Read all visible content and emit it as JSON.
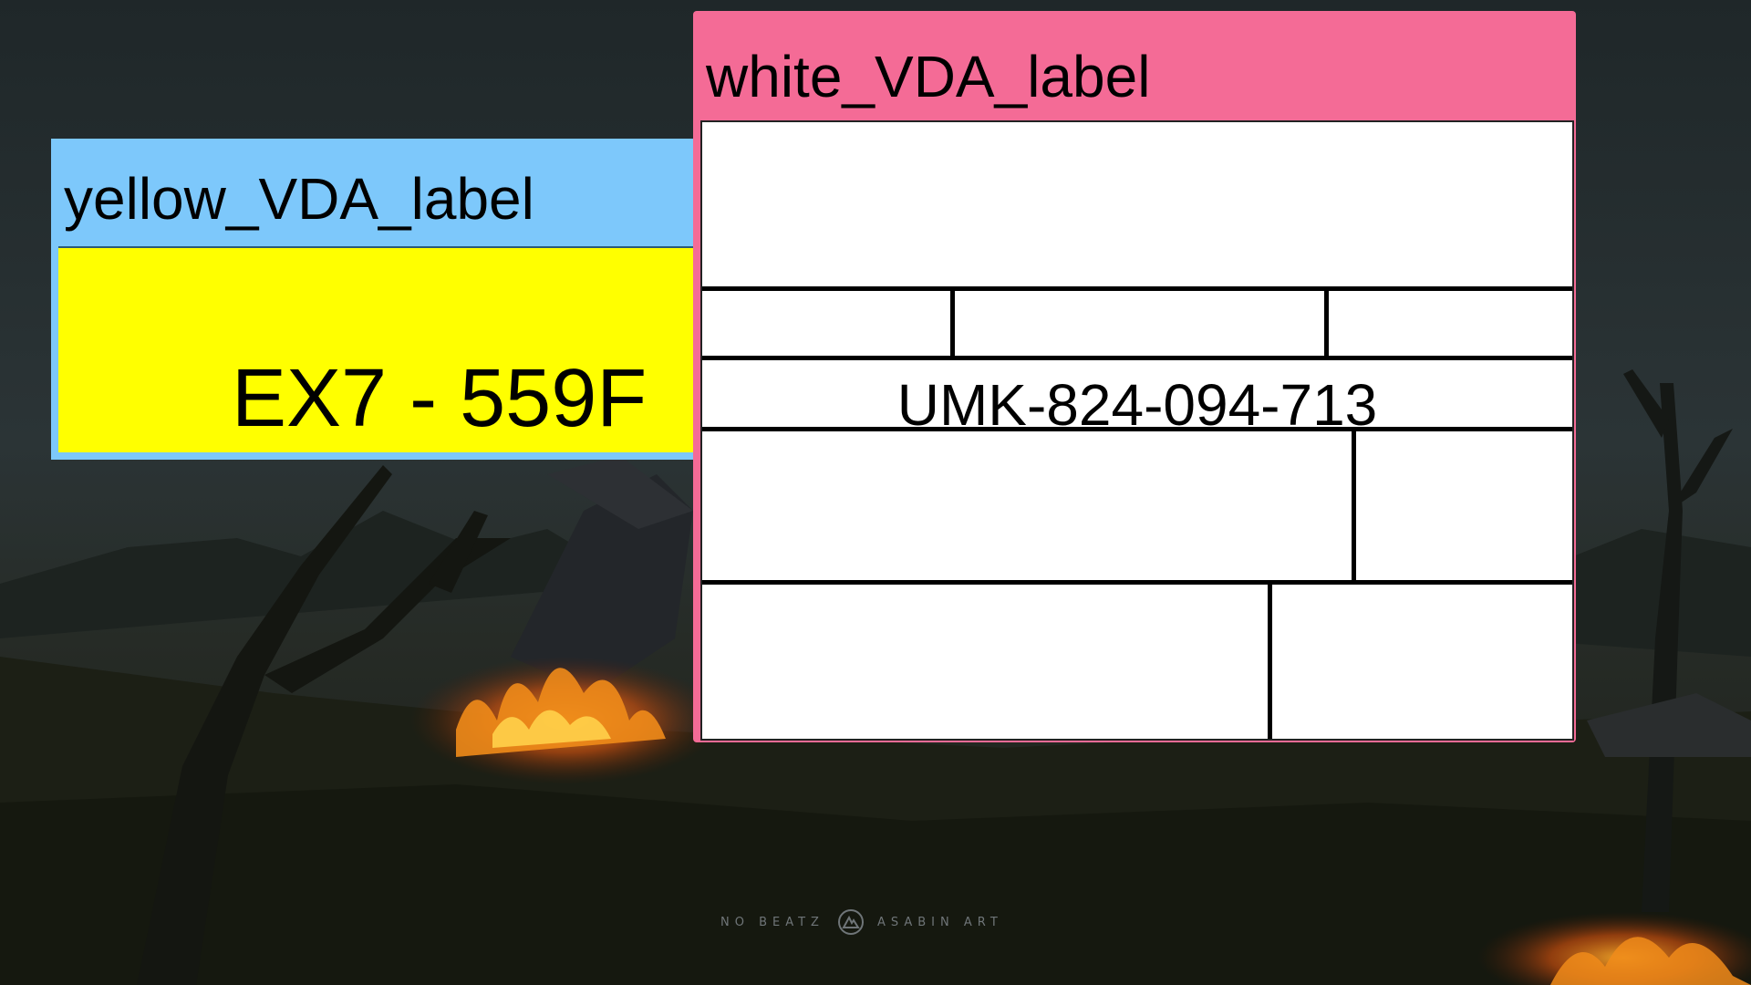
{
  "yellow_label": {
    "title": "yellow_VDA_label",
    "value": "EX7 - 559F"
  },
  "white_label": {
    "title": "white_VDA_label",
    "value": "UMK-824-094-713"
  },
  "watermark": {
    "left_text": "NO BEATZ",
    "right_text": "ASABIN ART",
    "icon": "mountain-logo-icon"
  },
  "colors": {
    "yellow_card_header": "#7dc8fb",
    "yellow_card_body": "#ffff00",
    "white_card_header": "#f46b96",
    "white_card_body": "#ffffff",
    "background": "#1e2628"
  }
}
